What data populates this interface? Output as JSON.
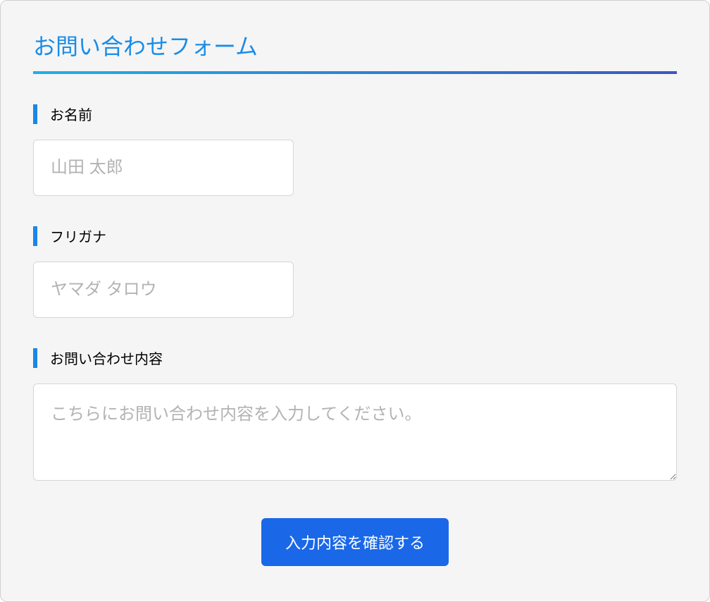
{
  "form": {
    "title": "お問い合わせフォーム",
    "fields": {
      "name": {
        "label": "お名前",
        "placeholder": "山田 太郎"
      },
      "furigana": {
        "label": "フリガナ",
        "placeholder": "ヤマダ タロウ"
      },
      "message": {
        "label": "お問い合わせ内容",
        "placeholder": "こちらにお問い合わせ内容を入力してください。"
      }
    },
    "submit_label": "入力内容を確認する"
  }
}
